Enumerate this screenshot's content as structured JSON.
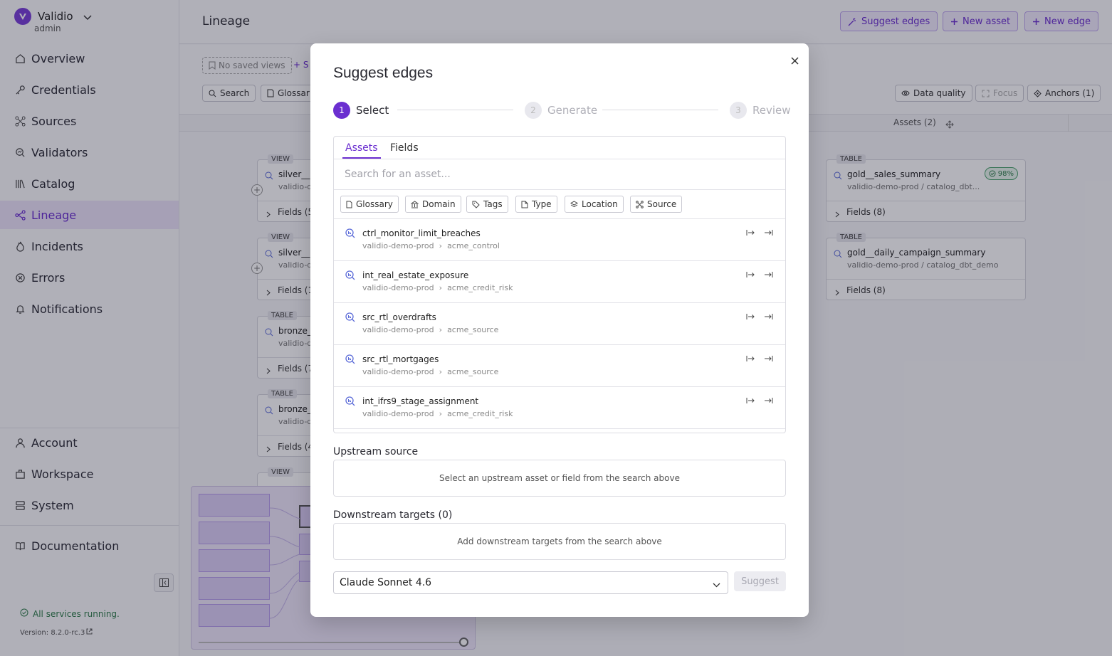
{
  "brand": {
    "name": "Validio",
    "role": "admin"
  },
  "nav": {
    "main": [
      {
        "label": "Overview",
        "icon": "home-icon"
      },
      {
        "label": "Credentials",
        "icon": "key-icon"
      },
      {
        "label": "Sources",
        "icon": "sources-icon"
      },
      {
        "label": "Validators",
        "icon": "validators-icon"
      },
      {
        "label": "Catalog",
        "icon": "catalog-icon"
      },
      {
        "label": "Lineage",
        "icon": "lineage-icon",
        "active": true
      },
      {
        "label": "Incidents",
        "icon": "flame-icon"
      },
      {
        "label": "Errors",
        "icon": "error-icon"
      },
      {
        "label": "Notifications",
        "icon": "bell-icon"
      }
    ],
    "secondary": [
      {
        "label": "Account",
        "icon": "user-icon"
      },
      {
        "label": "Workspace",
        "icon": "workspace-icon"
      },
      {
        "label": "System",
        "icon": "system-icon"
      }
    ],
    "documentation": "Documentation"
  },
  "footer": {
    "status": "All services running.",
    "version": "Version: 8.2.0-rc.3"
  },
  "page": {
    "title": "Lineage"
  },
  "top_actions": {
    "suggest": "Suggest edges",
    "new_asset": "New asset",
    "new_edge": "New edge"
  },
  "toolbar": {
    "saved_views": "No saved views",
    "save_prefix": "+ S",
    "search": "Search",
    "glossary": "Glossar",
    "data_quality": "Data quality",
    "focus": "Focus",
    "anchors": "Anchors (1)"
  },
  "columns": {
    "assets": "Assets (2)"
  },
  "background_nodes": {
    "left": [
      {
        "tag": "VIEW",
        "name": "silver__",
        "sub": "validio-d",
        "fields": "Fields (5"
      },
      {
        "tag": "VIEW",
        "name": "silver__",
        "sub": "validio-d",
        "fields": "Fields (1"
      },
      {
        "tag": "TABLE",
        "name": "bronze_",
        "sub": "validio-d",
        "fields": "Fields (7"
      },
      {
        "tag": "TABLE",
        "name": "bronze_",
        "sub": "validio-d",
        "fields": "Fields (4"
      },
      {
        "tag": "VIEW"
      }
    ],
    "right": [
      {
        "tag": "TABLE",
        "name": "gold__sales_summary",
        "sub": "validio-demo-prod / catalog_dbt...",
        "fields": "Fields (8)",
        "badge": "98%"
      },
      {
        "tag": "TABLE",
        "name": "gold__daily_campaign_summary",
        "sub": "validio-demo-prod / catalog_dbt_demo",
        "fields": "Fields (8)"
      }
    ]
  },
  "modal": {
    "title": "Suggest edges",
    "steps": [
      {
        "num": "1",
        "label": "Select"
      },
      {
        "num": "2",
        "label": "Generate"
      },
      {
        "num": "3",
        "label": "Review"
      }
    ],
    "tabs": [
      "Assets",
      "Fields"
    ],
    "search_placeholder": "Search for an asset...",
    "filters": [
      {
        "label": "Glossary",
        "icon": "glossary-icon"
      },
      {
        "label": "Domain",
        "icon": "domain-icon"
      },
      {
        "label": "Tags",
        "icon": "tag-icon"
      },
      {
        "label": "Type",
        "icon": "type-icon"
      },
      {
        "label": "Location",
        "icon": "location-icon"
      },
      {
        "label": "Source",
        "icon": "source-icon"
      }
    ],
    "results": [
      {
        "name": "ctrl_monitor_limit_breaches",
        "source": "validio-demo-prod",
        "schema": "acme_control"
      },
      {
        "name": "int_real_estate_exposure",
        "source": "validio-demo-prod",
        "schema": "acme_credit_risk"
      },
      {
        "name": "src_rtl_overdrafts",
        "source": "validio-demo-prod",
        "schema": "acme_source"
      },
      {
        "name": "src_rtl_mortgages",
        "source": "validio-demo-prod",
        "schema": "acme_source"
      },
      {
        "name": "int_ifrs9_stage_assignment",
        "source": "validio-demo-prod",
        "schema": "acme_credit_risk"
      }
    ],
    "upstream": {
      "label": "Upstream source",
      "empty": "Select an upstream asset or field from the search above"
    },
    "downstream": {
      "label": "Downstream targets (0)",
      "empty": "Add downstream targets from the search above"
    },
    "model": "Claude Sonnet 4.6",
    "suggest_button": "Suggest"
  },
  "colors": {
    "accent": "#6b2fd0",
    "success": "#2f7d4a"
  }
}
